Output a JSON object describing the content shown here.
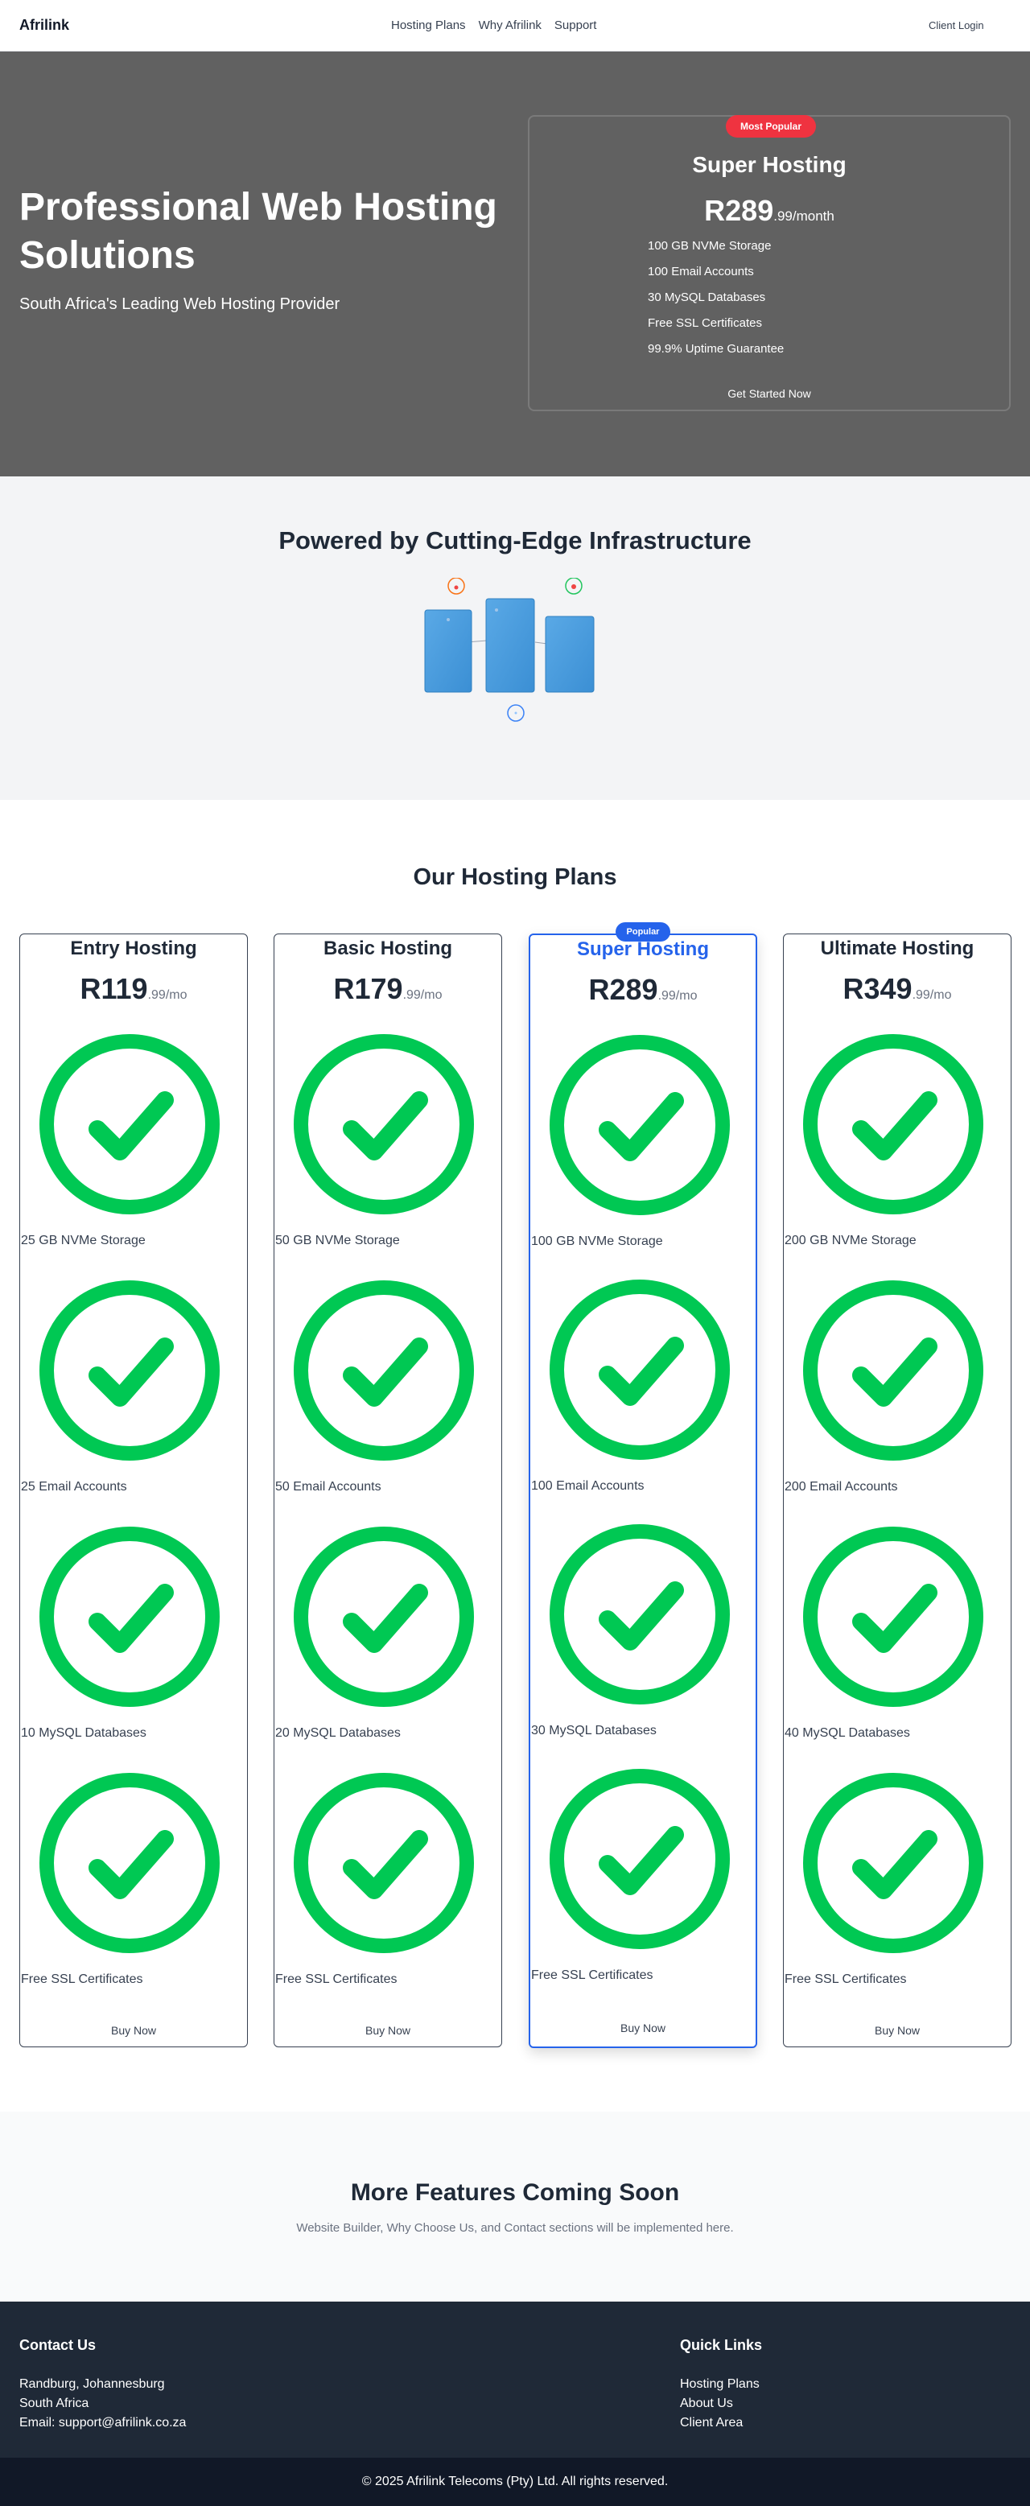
{
  "header": {
    "logo": "Afrilink",
    "nav": [
      "Hosting Plans",
      "Why Afrilink",
      "Support"
    ],
    "login_label": "Client Login"
  },
  "hero": {
    "title": "Professional Web Hosting Solutions",
    "subtitle": "South Africa's Leading Web Hosting Provider",
    "card": {
      "badge": "Most Popular",
      "title": "Super Hosting",
      "price_main": "R289",
      "price_suffix": ".99/month",
      "features": [
        "100 GB NVMe Storage",
        "100 Email Accounts",
        "30 MySQL Databases",
        "Free SSL Certificates",
        "99.9% Uptime Guarantee"
      ],
      "button": "Get Started Now"
    }
  },
  "infrastructure": {
    "title": "Powered by Cutting-Edge Infrastructure"
  },
  "plans": {
    "title": "Our Hosting Plans",
    "items": [
      {
        "name": "Entry Hosting",
        "price_main": "R119",
        "price_suffix": ".99/mo",
        "features": [
          "25 GB NVMe Storage",
          "25 Email Accounts",
          "10 MySQL Databases",
          "Free SSL Certificates"
        ],
        "button": "Buy Now"
      },
      {
        "name": "Basic Hosting",
        "price_main": "R179",
        "price_suffix": ".99/mo",
        "features": [
          "50 GB NVMe Storage",
          "50 Email Accounts",
          "20 MySQL Databases",
          "Free SSL Certificates"
        ],
        "button": "Buy Now"
      },
      {
        "name": "Super Hosting",
        "badge": "Popular",
        "price_main": "R289",
        "price_suffix": ".99/mo",
        "features": [
          "100 GB NVMe Storage",
          "100 Email Accounts",
          "30 MySQL Databases",
          "Free SSL Certificates"
        ],
        "button": "Buy Now"
      },
      {
        "name": "Ultimate Hosting",
        "price_main": "R349",
        "price_suffix": ".99/mo",
        "features": [
          "200 GB NVMe Storage",
          "200 Email Accounts",
          "40 MySQL Databases",
          "Free SSL Certificates"
        ],
        "button": "Buy Now"
      }
    ]
  },
  "more": {
    "title": "More Features Coming Soon",
    "subtitle": "Website Builder, Why Choose Us, and Contact sections will be implemented here."
  },
  "footer": {
    "contact_title": "Contact Us",
    "contact_lines": [
      "Randburg, Johannesburg",
      "South Africa",
      "Email: support@afrilink.co.za"
    ],
    "links_title": "Quick Links",
    "links": [
      "Hosting Plans",
      "About Us",
      "Client Area"
    ],
    "copyright": "© 2025 Afrilink Telecoms (Pty) Ltd. All rights reserved."
  },
  "colors": {
    "check": "#00c853",
    "accent_blue": "#2563eb",
    "badge_red": "#ef3340",
    "hero_bg": "#616161",
    "footer_bg": "#1f2937"
  },
  "icons": [
    "check-circle-icon",
    "server-icon"
  ]
}
